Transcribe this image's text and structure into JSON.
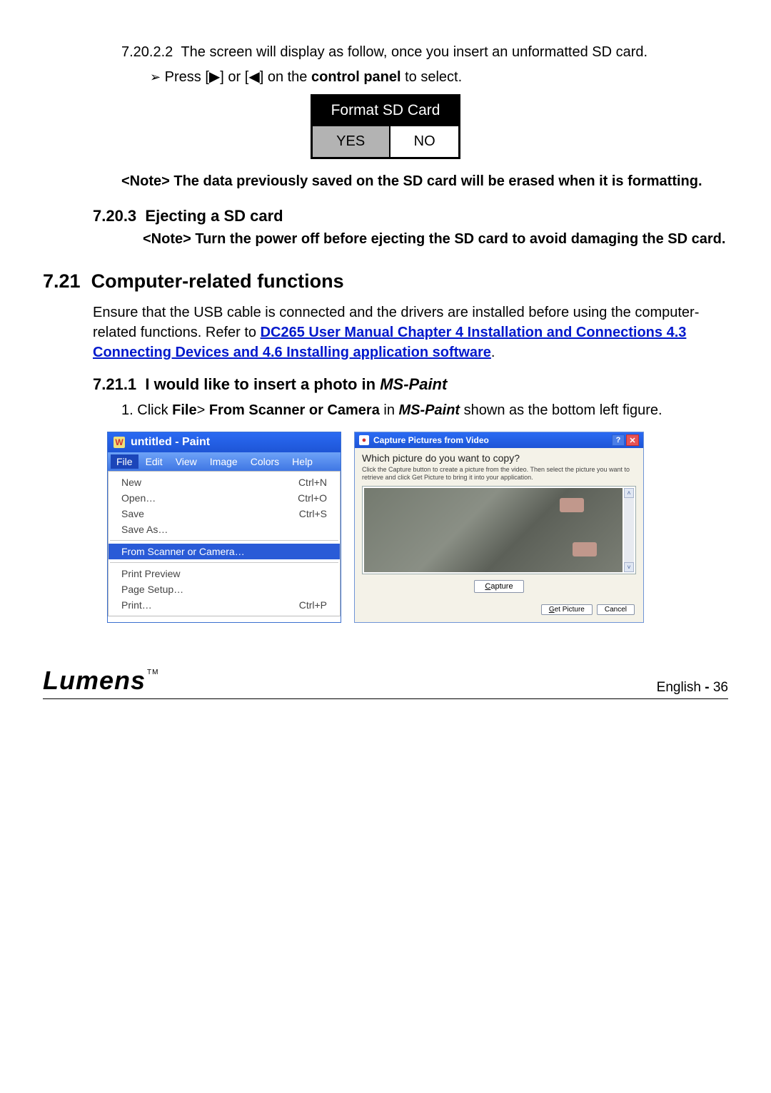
{
  "s7_20_2_2": {
    "num": "7.20.2.2",
    "text": "The screen will display as follow, once you insert an unformatted SD card.",
    "bullet_prefix": "➢",
    "bullet_a": "Press [",
    "bullet_b": "] or [",
    "bullet_c": "] on the ",
    "bullet_bold": "control panel",
    "bullet_d": " to select.",
    "left_tri": "◀",
    "right_tri": "▶"
  },
  "format_table": {
    "header": "Format SD Card",
    "yes": "YES",
    "no": "NO"
  },
  "note_format": "<Note> The data previously saved on the SD card will be erased when it is formatting.",
  "s7_20_3": {
    "num": "7.20.3",
    "title": "Ejecting a SD card",
    "note": "<Note> Turn the power off before ejecting the SD card to avoid damaging the SD card."
  },
  "s7_21": {
    "num": "7.21",
    "title": "Computer-related functions",
    "para_a": "Ensure that the USB cable is connected and the drivers are installed before using the computer-related functions. Refer to ",
    "link": "DC265 User Manual Chapter 4 Installation and Connections 4.3 Connecting Devices and 4.6 Installing application software",
    "para_b": "."
  },
  "s7_21_1": {
    "num": "7.21.1",
    "title_a": "I would like to insert a photo in ",
    "title_italic": "MS-Paint",
    "step_num": "1.",
    "step_a": "Click ",
    "step_b1": "File",
    "step_gt": "> ",
    "step_b2": "From Scanner or Camera",
    "step_c": " in ",
    "step_italic": "MS-Paint",
    "step_d": " shown as the bottom left figure."
  },
  "paint": {
    "title": "untitled - Paint",
    "menu": {
      "file": "File",
      "edit": "Edit",
      "view": "View",
      "image": "Image",
      "colors": "Colors",
      "help": "Help"
    },
    "items": {
      "new": {
        "label": "New",
        "shortcut": "Ctrl+N"
      },
      "open": {
        "label": "Open…",
        "shortcut": "Ctrl+O"
      },
      "save": {
        "label": "Save",
        "shortcut": "Ctrl+S"
      },
      "saveas": {
        "label": "Save As…",
        "shortcut": ""
      },
      "scanner": {
        "label": "From Scanner or Camera…",
        "shortcut": ""
      },
      "preview": {
        "label": "Print Preview",
        "shortcut": ""
      },
      "pagesetup": {
        "label": "Page Setup…",
        "shortcut": ""
      },
      "print": {
        "label": "Print…",
        "shortcut": "Ctrl+P"
      }
    }
  },
  "capture": {
    "title": "Capture Pictures from Video",
    "question": "Which picture do you want to copy?",
    "instr": "Click the Capture button to create a picture from the video. Then select the picture you want to retrieve and click Get Picture to bring it into your application.",
    "capture_btn": "Capture",
    "get_picture": "Get Picture",
    "cancel": "Cancel",
    "help": "?",
    "close": "✕",
    "up": "˄",
    "down": "˅"
  },
  "footer": {
    "logo": "Lumens",
    "tm": "TM",
    "lang": "English",
    "sep": " - ",
    "page": "36"
  }
}
